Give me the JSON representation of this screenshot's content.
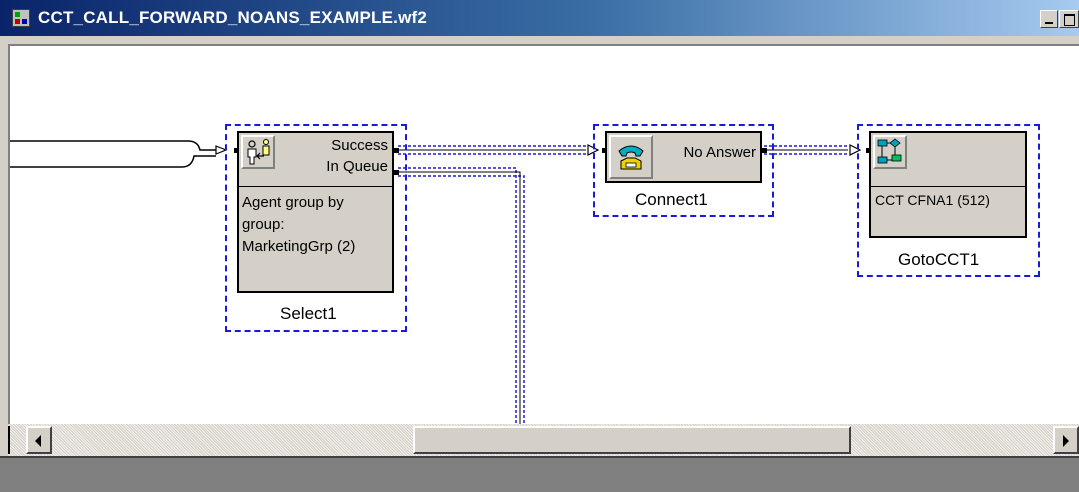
{
  "window": {
    "title": "CCT_CALL_FORWARD_NOANS_EXAMPLE.wf2",
    "icon": "workflow-app-icon",
    "controls": [
      "minimize-icon",
      "maximize-icon"
    ]
  },
  "nodes": {
    "select": {
      "name": "Select1",
      "icon": "agent-select-icon",
      "outputs": [
        "Success",
        "In Queue"
      ],
      "lines": [
        "Agent group by",
        "group:",
        "MarketingGrp (2)"
      ]
    },
    "connect": {
      "name": "Connect1",
      "icon": "telephone-connect-icon",
      "outputs": [
        "No Answer"
      ]
    },
    "goto": {
      "name": "GotoCCT1",
      "icon": "goto-cct-icon",
      "lines": [
        "CCT CFNA1 (512)"
      ]
    }
  },
  "scrollbar": {
    "left_icon": "scroll-left-arrow-icon",
    "right_icon": "scroll-right-arrow-icon"
  },
  "colors": {
    "selection": "#1a1adc",
    "title_bar_start": "#0a246a",
    "title_bar_end": "#a6caf0",
    "node_face": "#d4d0c8"
  }
}
